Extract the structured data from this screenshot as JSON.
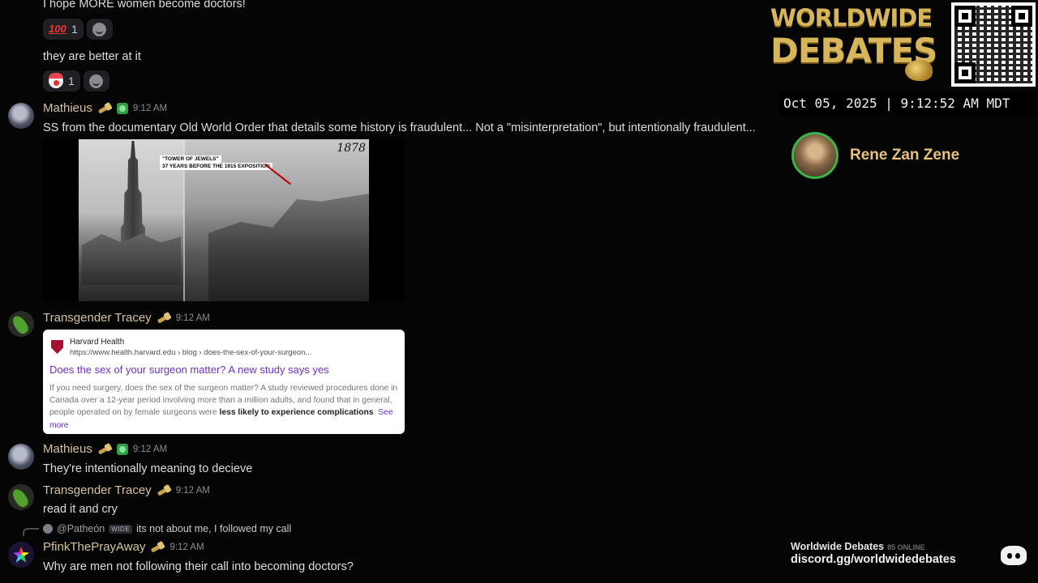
{
  "messages": {
    "m1_text": "I hope MORE women become doctors!",
    "m1_reaction_count": "1",
    "m2_text": "they are better at it",
    "m2_reaction_count": "1",
    "m3_author": "Mathieus",
    "m3_time": "9:12 AM",
    "m3_text": "SS from the documentary Old World Order that details some history is fraudulent... Not a \"misinterpretation\", but intentionally fraudulent...",
    "m4_author": "Transgender Tracey",
    "m4_time": "9:12 AM",
    "m5_author": "Mathieus",
    "m5_time": "9:12 AM",
    "m5_text": "They're intentionally meaning to decieve",
    "m6_author": "Transgender Tracey",
    "m6_time": "9:12 AM",
    "m6_text": "read it and cry",
    "m7_author": "PfinkThePrayAway",
    "m7_time": "9:12 AM",
    "m7_text": "Why are men not following their call into becoming doctors?"
  },
  "photo": {
    "year": "1878",
    "caption": "37 YEARS BEFORE THE 1915 EXPOSITION",
    "caption_top": "\"TOWER OF JEWELS\""
  },
  "embed": {
    "site": "Harvard Health",
    "url": "https://www.health.harvard.edu › blog › does-the-sex-of-your-surgeon...",
    "title": "Does the sex of your surgeon matter? A new study says yes",
    "desc_plain": "If you need surgery, does the sex of the surgeon matter? A study reviewed procedures done in Canada over a 12-year period involving more than a million adults, and found that in general, people operated on by female surgeons were ",
    "desc_bold": "less likely to experience complications",
    "desc_end": ". ",
    "see_more": "See more"
  },
  "reply": {
    "user": "@Patheón",
    "tag": "WIDE",
    "text": "its not about me, I followed my call"
  },
  "overlay": {
    "brand_line1": "WORLDWIDE",
    "brand_line2": "DEBATES",
    "datetime": "Oct 05, 2025 | 9:12:52 AM MDT",
    "speaker": "Rene Zan Zene",
    "discord_name": "Worldwide Debates",
    "discord_online": "85 ONLINE",
    "discord_link": "discord.gg/worldwidedebates"
  },
  "colors": {
    "author": "#d6c39b",
    "link": "#6a32c9",
    "brand_gold": "#d7b55a",
    "speaker_ring": "#3bb54a"
  },
  "icons": [
    "hundred-emoji",
    "clown-emoji",
    "add-reaction-icon",
    "hammer-badge-icon",
    "leaf-badge-icon",
    "harvard-shield-icon",
    "discord-icon"
  ]
}
